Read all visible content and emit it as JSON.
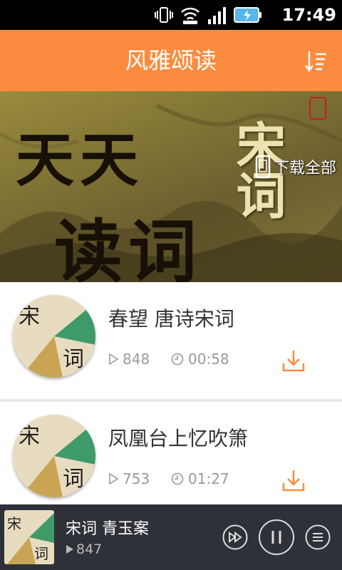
{
  "status_bar": {
    "time": "17:49"
  },
  "header": {
    "title": "风雅颂读",
    "sort_icon": "sort-list-icon"
  },
  "banner": {
    "line1": "天天",
    "line2": "读词",
    "side_text": "宋词",
    "download_all_label": "下载全部"
  },
  "items": [
    {
      "title": "春望 唐诗宋词",
      "plays": "848",
      "duration": "00:58"
    },
    {
      "title": "凤凰台上忆吹箫",
      "plays": "753",
      "duration": "01:27"
    }
  ],
  "player": {
    "title": "宋词 青玉案",
    "plays": "847"
  },
  "colors": {
    "accent": "#fb8c3f",
    "player_bg": "#2f3138",
    "divider": "#e9e9e9"
  }
}
